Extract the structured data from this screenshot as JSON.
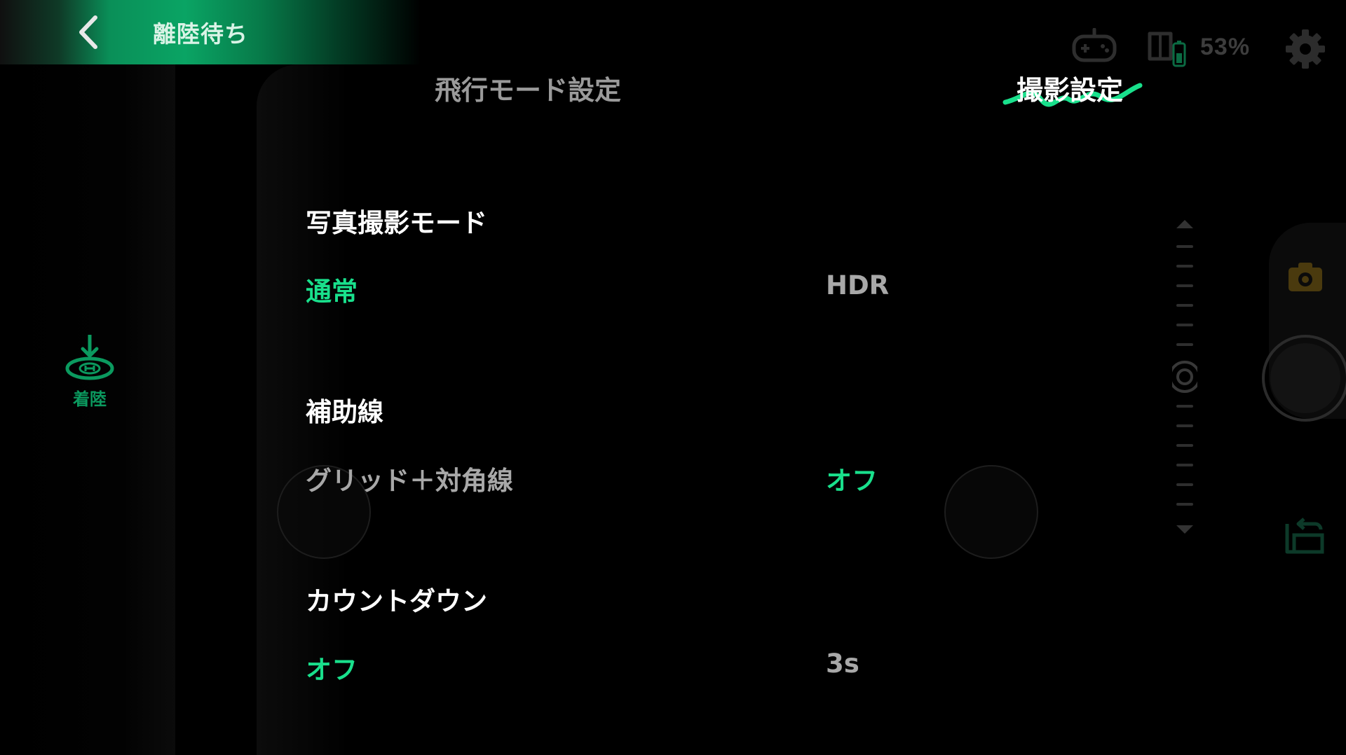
{
  "status": {
    "back_icon": "chevron-left-icon",
    "text": "離陸待ち",
    "accent": "#0aa464"
  },
  "topbar": {
    "controller_icon": "gamepad-icon",
    "battery_icon": "battery-icon",
    "battery_percent": "53%",
    "settings_icon": "gear-icon"
  },
  "left": {
    "land_icon": "landing-icon",
    "land_label": "着陸"
  },
  "tabs": [
    {
      "label": "飛行モード設定",
      "active": false
    },
    {
      "label": "撮影設定",
      "active": true
    }
  ],
  "sections": {
    "photo_mode": {
      "title": "写真撮影モード",
      "options": [
        {
          "label": "通常",
          "active": true
        },
        {
          "label": "HDR",
          "active": false
        }
      ]
    },
    "guides": {
      "title": "補助線",
      "options": [
        {
          "label": "グリッド＋対角線",
          "active": false
        },
        {
          "label": "オフ",
          "active": true
        }
      ]
    },
    "countdown": {
      "title": "カウントダウン",
      "options": [
        {
          "label": "オフ",
          "active": true
        },
        {
          "label": "3s",
          "active": false
        }
      ]
    }
  },
  "right": {
    "zoom_icon": "zoom-slider-icon",
    "photo_icon": "camera-icon",
    "shutter_icon": "shutter-button",
    "switch_icon": "switch-view-icon"
  },
  "colors": {
    "active_green": "#19e08c",
    "inactive_gray": "#a8a8a8",
    "background": "#000000"
  }
}
